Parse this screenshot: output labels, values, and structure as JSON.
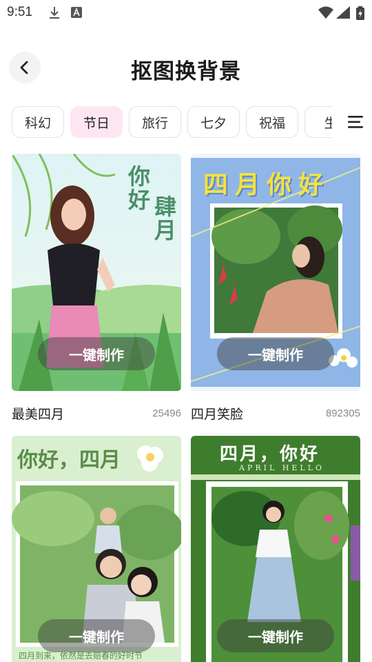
{
  "status_bar": {
    "time": "9:51",
    "icons": [
      "download-icon",
      "text-a-icon",
      "wifi-icon",
      "signal-icon",
      "battery-charging-icon"
    ]
  },
  "header": {
    "back_icon": "chevron-left-icon",
    "title": "抠图换背景"
  },
  "tabs": {
    "items": [
      {
        "label": "科幻",
        "active": false
      },
      {
        "label": "节日",
        "active": true
      },
      {
        "label": "旅行",
        "active": false
      },
      {
        "label": "七夕",
        "active": false
      },
      {
        "label": "祝福",
        "active": false
      },
      {
        "label": "生",
        "active": false
      }
    ],
    "menu_icon": "menu-icon",
    "active_color": "#fde6f2"
  },
  "templates": [
    {
      "name": "最美四月",
      "count": "25496",
      "button_label": "一键制作",
      "poster_text": {
        "line1": "你好",
        "line2": "肆月"
      }
    },
    {
      "name": "四月笑脸",
      "count": "892305",
      "button_label": "一键制作",
      "poster_text": {
        "title": "四月你好"
      }
    },
    {
      "name": "",
      "count": "",
      "button_label": "一键制作",
      "poster_text": {
        "title": "你好，四月",
        "footer": "四月到来，依然是去赔春的好时节"
      }
    },
    {
      "name": "",
      "count": "",
      "button_label": "一键制作",
      "poster_text": {
        "title": "四月，你好",
        "subtitle": "APRIL HELLO"
      }
    }
  ]
}
